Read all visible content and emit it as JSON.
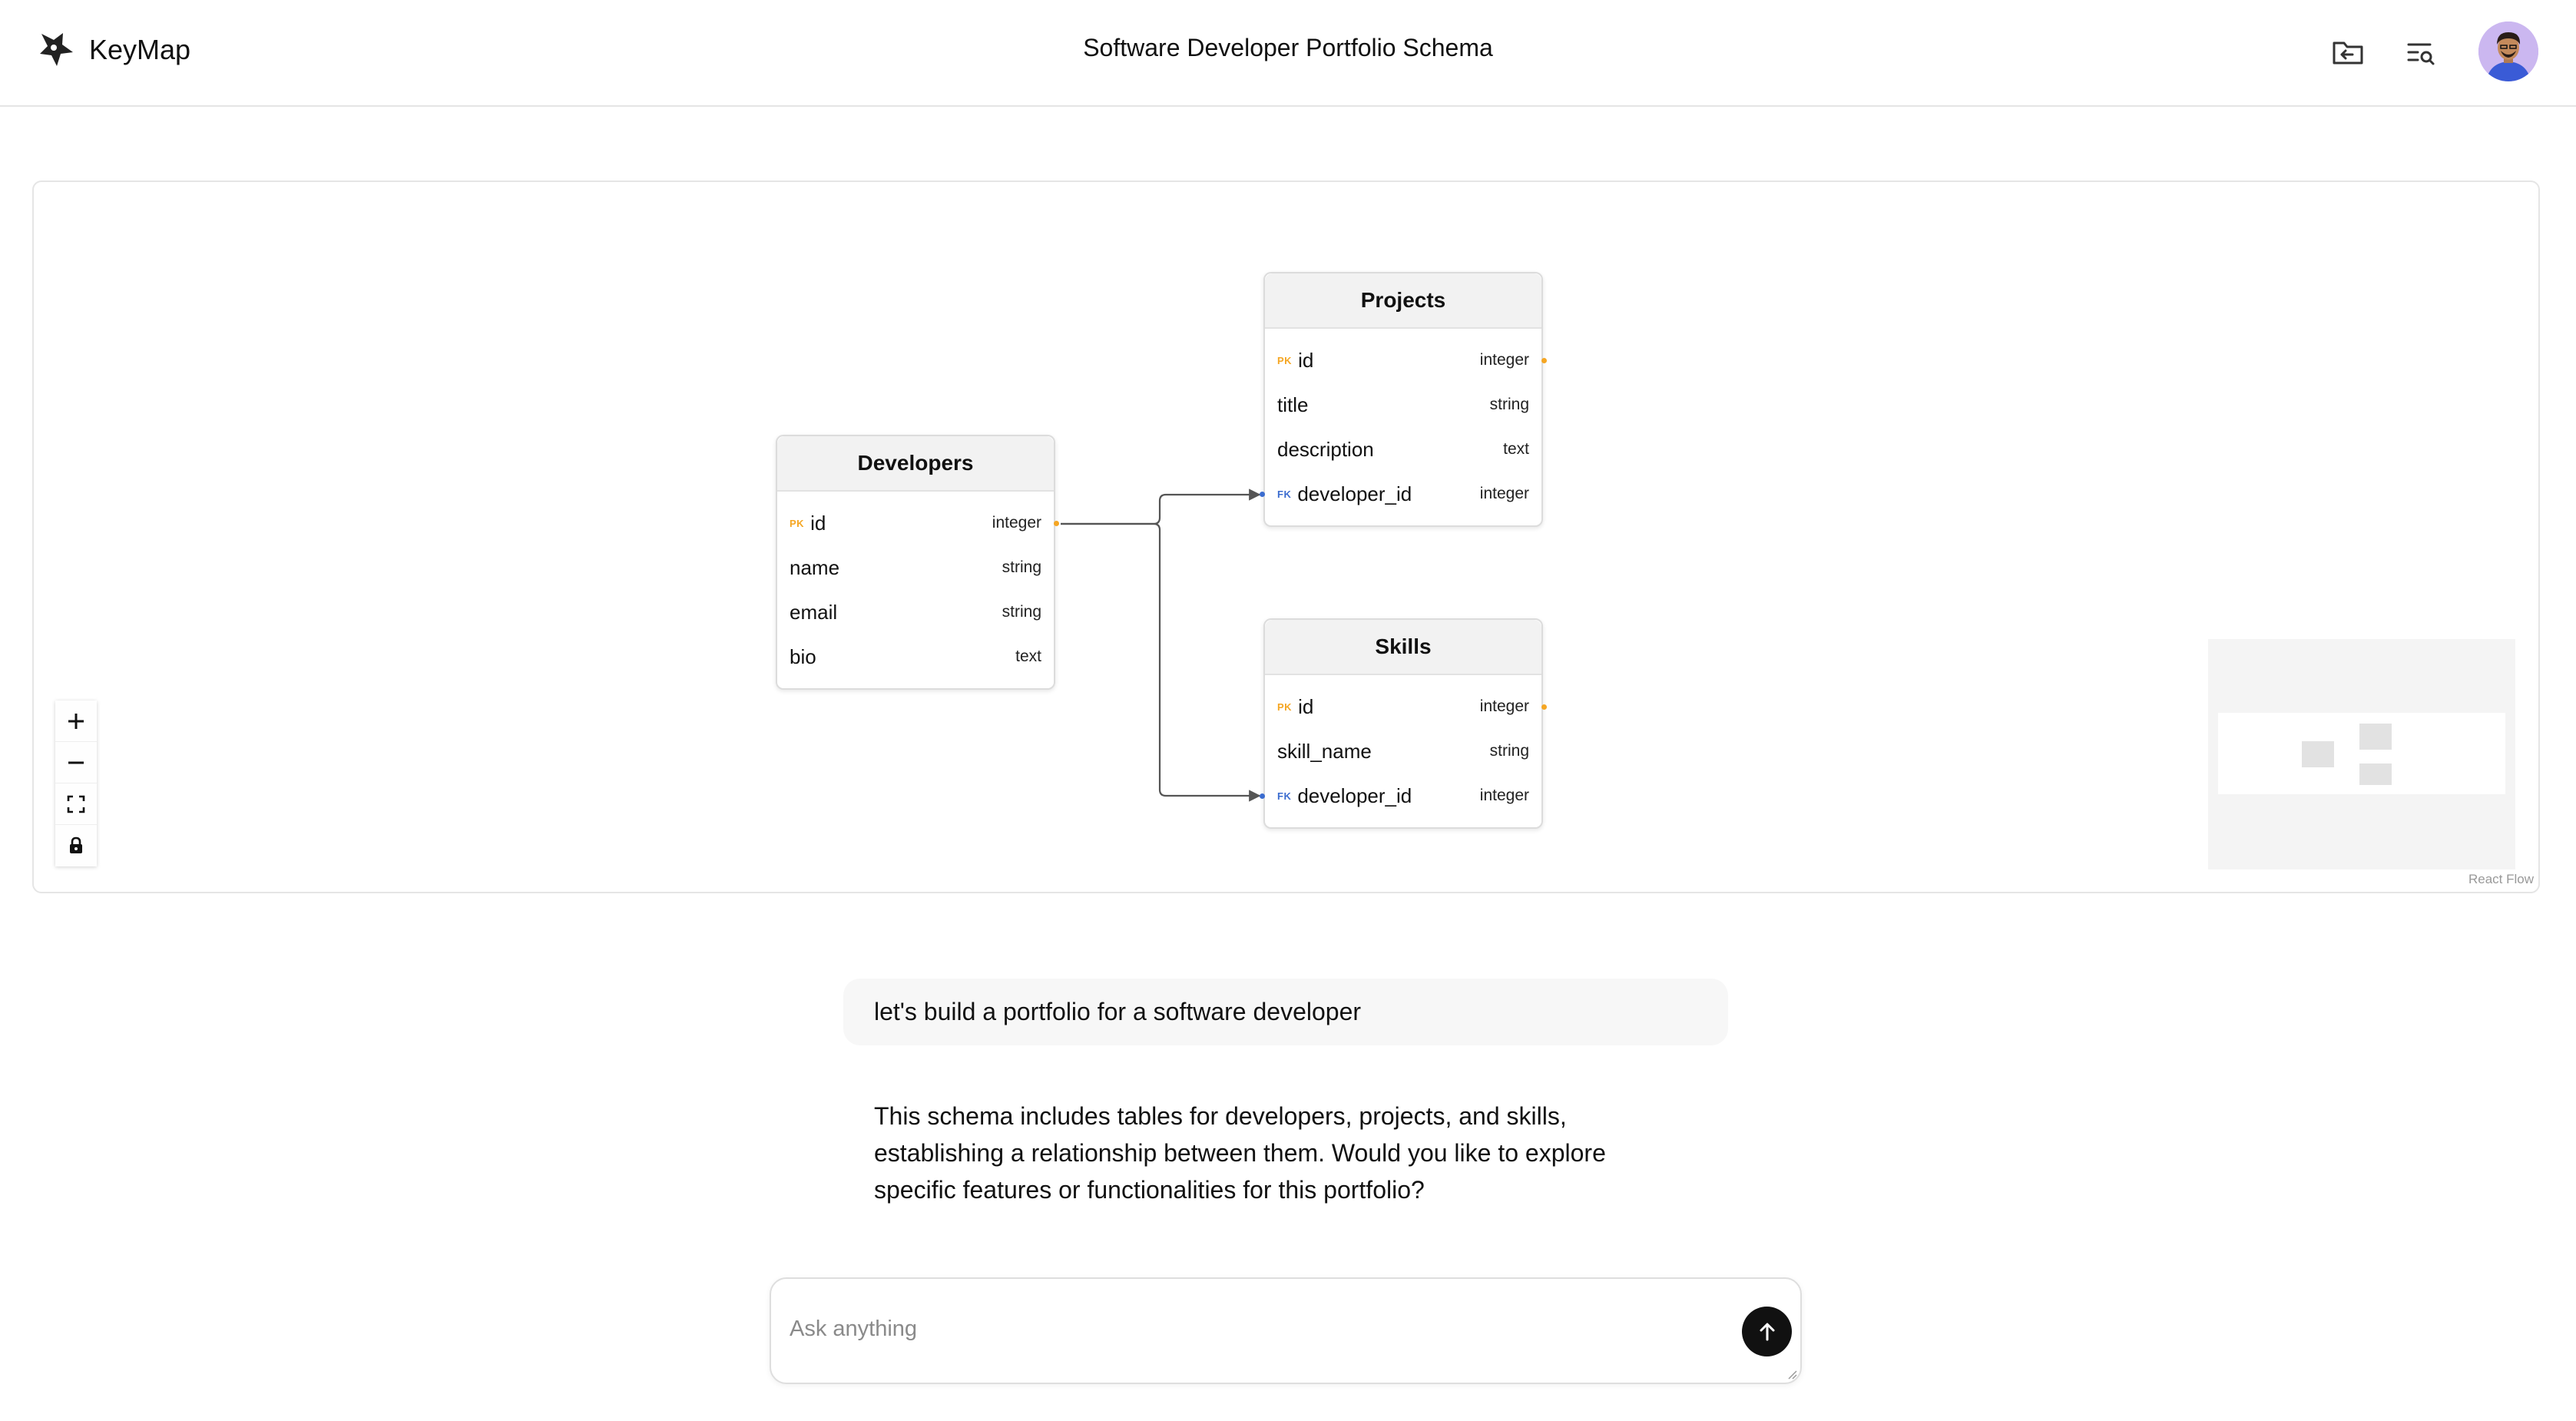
{
  "app": {
    "name": "KeyMap",
    "logo_icon": "star-burst-logo-icon"
  },
  "header": {
    "title": "Software Developer Portfolio Schema",
    "buttons": [
      {
        "name": "folder-back-icon"
      },
      {
        "name": "list-search-icon"
      }
    ],
    "avatar": "user-avatar"
  },
  "schema": {
    "tables": [
      {
        "name": "Developers",
        "columns": [
          {
            "key": "PK",
            "name": "id",
            "type": "integer"
          },
          {
            "key": "",
            "name": "name",
            "type": "string"
          },
          {
            "key": "",
            "name": "email",
            "type": "string"
          },
          {
            "key": "",
            "name": "bio",
            "type": "text"
          }
        ]
      },
      {
        "name": "Projects",
        "columns": [
          {
            "key": "PK",
            "name": "id",
            "type": "integer"
          },
          {
            "key": "",
            "name": "title",
            "type": "string"
          },
          {
            "key": "",
            "name": "description",
            "type": "text"
          },
          {
            "key": "FK",
            "name": "developer_id",
            "type": "integer"
          }
        ]
      },
      {
        "name": "Skills",
        "columns": [
          {
            "key": "PK",
            "name": "id",
            "type": "integer"
          },
          {
            "key": "",
            "name": "skill_name",
            "type": "string"
          },
          {
            "key": "FK",
            "name": "developer_id",
            "type": "integer"
          }
        ]
      }
    ],
    "relations": [
      {
        "from": "Developers.id",
        "to": "Projects.developer_id"
      },
      {
        "from": "Developers.id",
        "to": "Skills.developer_id"
      }
    ]
  },
  "flow_controls": [
    "zoom-in-icon",
    "zoom-out-icon",
    "fit-view-icon",
    "lock-icon"
  ],
  "attribution": "React Flow",
  "chat": {
    "user_message": "let's build a portfolio for a software developer",
    "assistant_lines": [
      "This schema includes tables for developers, projects, and skills,",
      "establishing a relationship between them. Would you like to explore",
      "specific features or functionalities for this portfolio?"
    ],
    "input_placeholder": "Ask anything",
    "input_value": ""
  },
  "colors": {
    "pk": "#f5a623",
    "fk": "#3b6ccf",
    "edge": "#555555",
    "send_button": "#111111"
  }
}
